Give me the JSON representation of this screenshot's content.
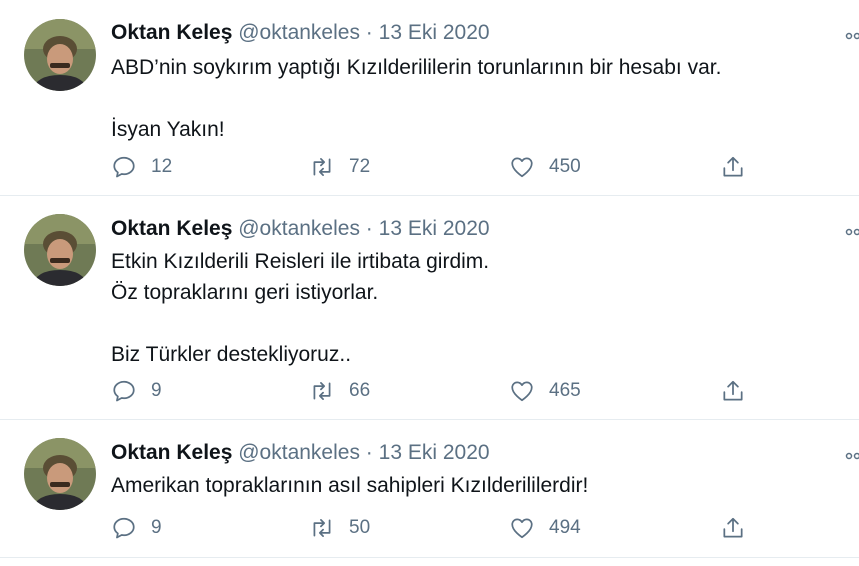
{
  "tweets": [
    {
      "name": "Oktan Keleş",
      "handle": "@oktankeles",
      "separator": "·",
      "date": "13 Eki 2020",
      "text": "ABD’nin soykırım yaptığı Kızılderililerin torunlarının bir hesabı var.\n\nİsyan Yakın!",
      "replies": "12",
      "retweets": "72",
      "likes": "450"
    },
    {
      "name": "Oktan Keleş",
      "handle": "@oktankeles",
      "separator": "·",
      "date": "13 Eki 2020",
      "text": "Etkin Kızılderili Reisleri ile irtibata girdim.\nÖz topraklarını geri istiyorlar.\n\nBiz Türkler destekliyoruz..",
      "replies": "9",
      "retweets": "66",
      "likes": "465"
    },
    {
      "name": "Oktan Keleş",
      "handle": "@oktankeles",
      "separator": "·",
      "date": "13 Eki 2020",
      "text": "Amerikan topraklarının asıl sahipleri Kızılderililerdir!",
      "replies": "9",
      "retweets": "50",
      "likes": "494"
    }
  ],
  "icons": {
    "reply": "reply-icon",
    "retweet": "retweet-icon",
    "like": "heart-icon",
    "share": "share-icon",
    "more": "more-icon"
  },
  "colors": {
    "text": "#0f1419",
    "secondary": "#5b7083",
    "border": "#e6ecf0"
  }
}
